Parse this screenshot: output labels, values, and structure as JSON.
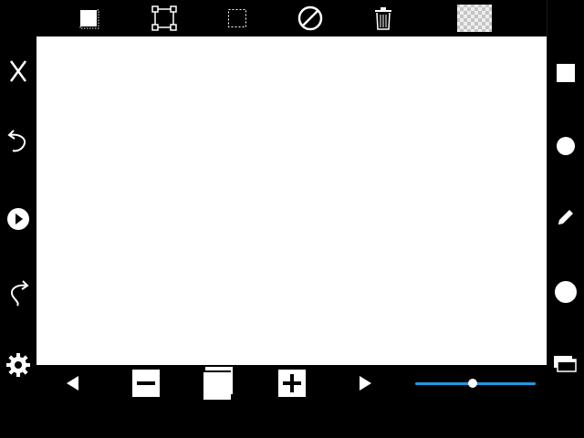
{
  "colors": {
    "background": "#000000",
    "canvas": "#ffffff",
    "icon": "#ffffff",
    "slider_accent": "#1e9be6"
  },
  "top_toolbar": [
    "fill-square-icon",
    "transform-select-icon",
    "marquee-select-icon",
    "no-symbol-icon",
    "trash-icon",
    "transparency-swatch"
  ],
  "left_toolbar": [
    "close-icon",
    "undo-icon",
    "play-icon",
    "redo-icon",
    "settings-gear-icon"
  ],
  "right_toolbar": [
    "square-shape-icon",
    "circle-shape-icon",
    "pencil-icon",
    "brush-dot-icon",
    "layers-icon"
  ],
  "bottom_toolbar": [
    "previous-arrow-icon",
    "minus-icon",
    "pages-icon",
    "plus-icon",
    "next-arrow-icon"
  ],
  "size_slider": {
    "value": 0.48
  }
}
